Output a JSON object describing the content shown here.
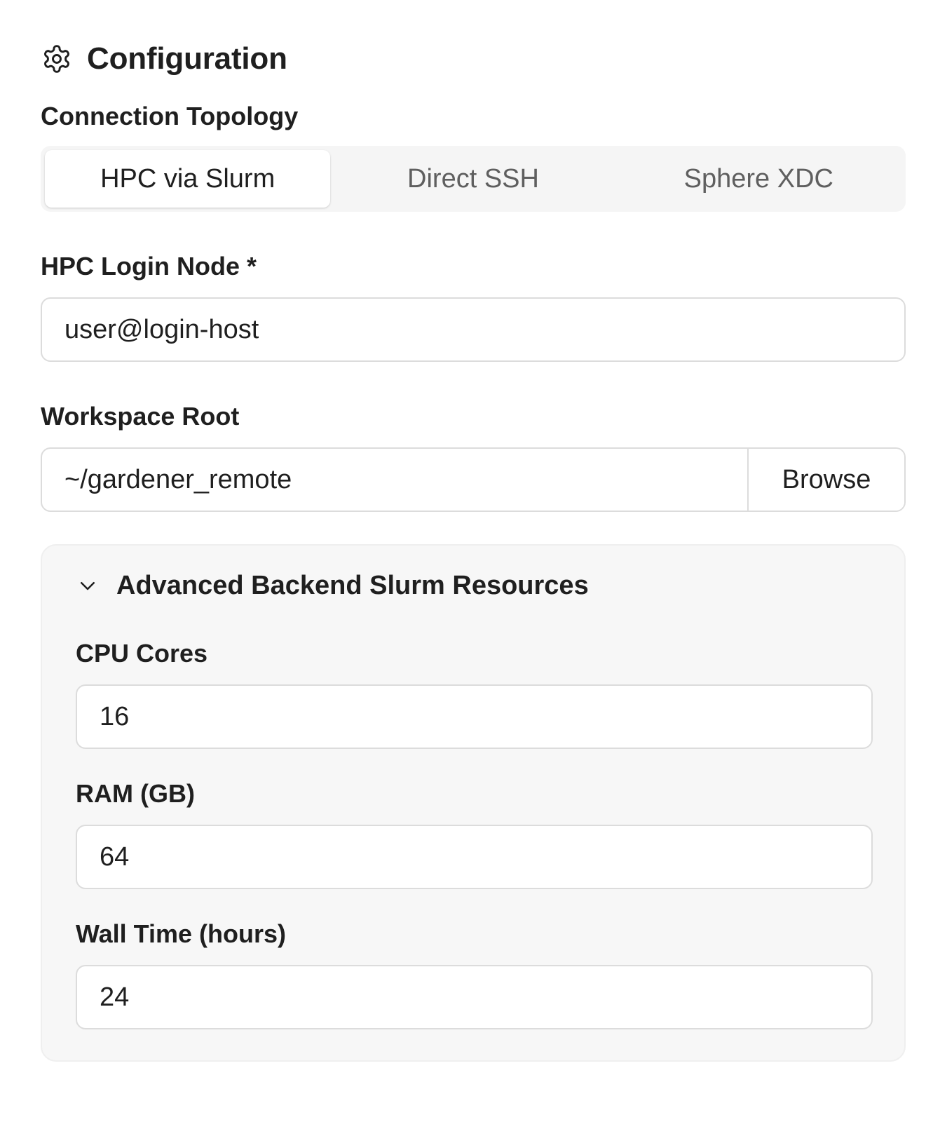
{
  "header": {
    "title": "Configuration",
    "icon": "gear-icon"
  },
  "topology": {
    "label": "Connection Topology",
    "options": [
      "HPC via Slurm",
      "Direct SSH",
      "Sphere XDC"
    ],
    "selected": "HPC via Slurm"
  },
  "login_node": {
    "label": "HPC Login Node *",
    "value": "user@login-host"
  },
  "workspace": {
    "label": "Workspace Root",
    "value": "~/gardener_remote",
    "browse_label": "Browse"
  },
  "advanced": {
    "title": "Advanced Backend Slurm Resources",
    "expanded": true,
    "icon": "chevron-down-icon",
    "cpu": {
      "label": "CPU Cores",
      "value": "16"
    },
    "ram": {
      "label": "RAM (GB)",
      "value": "64"
    },
    "wall_time": {
      "label": "Wall Time (hours)",
      "value": "24"
    }
  },
  "colors": {
    "text": "#1f1f1f",
    "muted_text": "#5f5f5f",
    "border": "#dcdcdc",
    "panel_bg": "#f7f7f7",
    "segmented_bg": "#f5f5f5"
  }
}
